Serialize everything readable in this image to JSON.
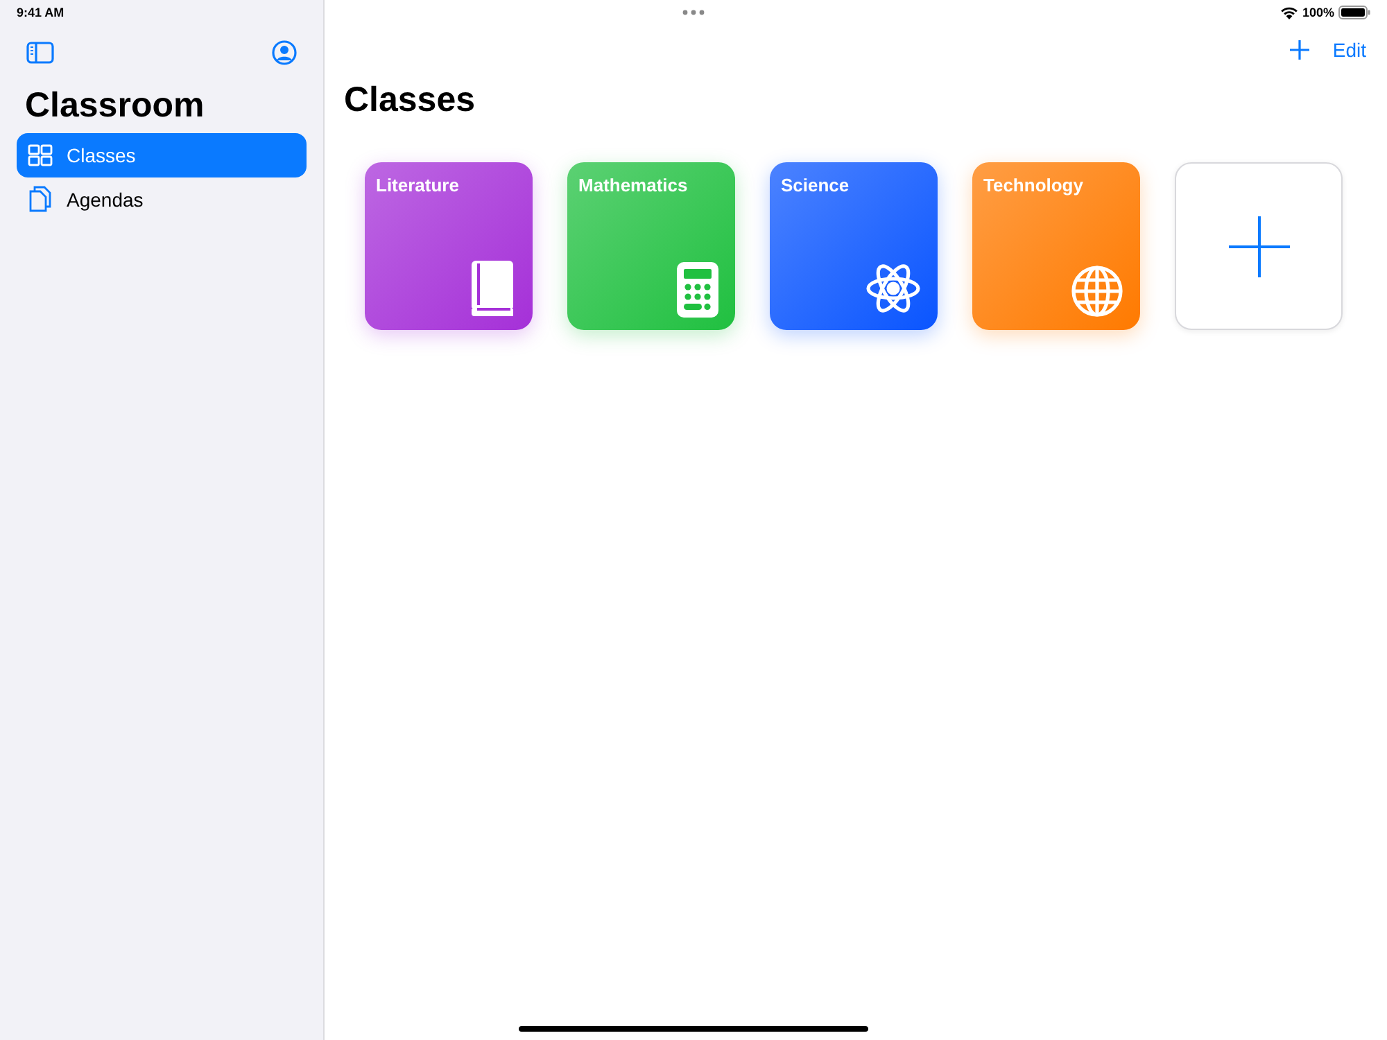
{
  "status_bar": {
    "time": "9:41 AM",
    "battery": "100%"
  },
  "sidebar": {
    "title": "Classroom",
    "items": [
      {
        "label": "Classes",
        "kind": "grid",
        "selected": true
      },
      {
        "label": "Agendas",
        "kind": "documents",
        "selected": false
      }
    ]
  },
  "toolbar": {
    "edit": "Edit"
  },
  "main": {
    "title": "Classes",
    "cards": [
      {
        "kind": "book",
        "title": "Literature",
        "color": "#a530d8"
      },
      {
        "kind": "calculator",
        "title": "Mathematics",
        "color": "#20c040"
      },
      {
        "kind": "atom",
        "title": "Science",
        "color": "#0a55ff"
      },
      {
        "kind": "globe",
        "title": "Technology",
        "color": "#ff7a00"
      },
      {
        "kind": "add"
      }
    ]
  }
}
